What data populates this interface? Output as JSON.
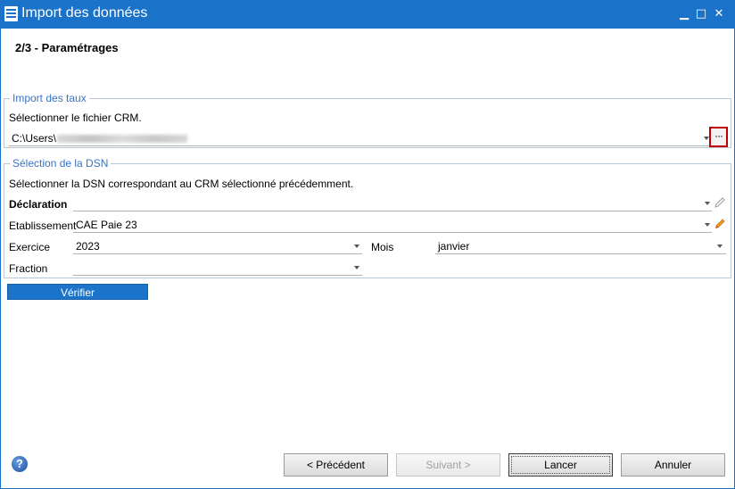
{
  "window": {
    "title": "Import des données",
    "minimize": "▁",
    "maximize": "□",
    "close": "✕"
  },
  "step": {
    "title": "2/3 - Paramétrages"
  },
  "import_taux": {
    "legend": "Import des taux",
    "instruction": "Sélectionner le fichier CRM.",
    "file_path_prefix": "C:\\Users\\",
    "browse_label": "···"
  },
  "selection_dsn": {
    "legend": "Sélection de la DSN",
    "instruction": "Sélectionner la DSN correspondant au CRM sélectionné précédemment.",
    "declaration_label": "Déclaration",
    "declaration_value": "",
    "etablissement_label": "Etablissement",
    "etablissement_value": "CAE Paie 23",
    "exercice_label": "Exercice",
    "exercice_value": "2023",
    "mois_label": "Mois",
    "mois_value": "janvier",
    "fraction_label": "Fraction",
    "fraction_value": ""
  },
  "verify_button": "Vérifier",
  "footer": {
    "help": "?",
    "previous": "< Précédent",
    "next": "Suivant >",
    "launch": "Lancer",
    "cancel": "Annuler"
  },
  "colors": {
    "titlebar": "#1a73c9",
    "legend": "#3a73c4",
    "highlight": "#c00000"
  }
}
